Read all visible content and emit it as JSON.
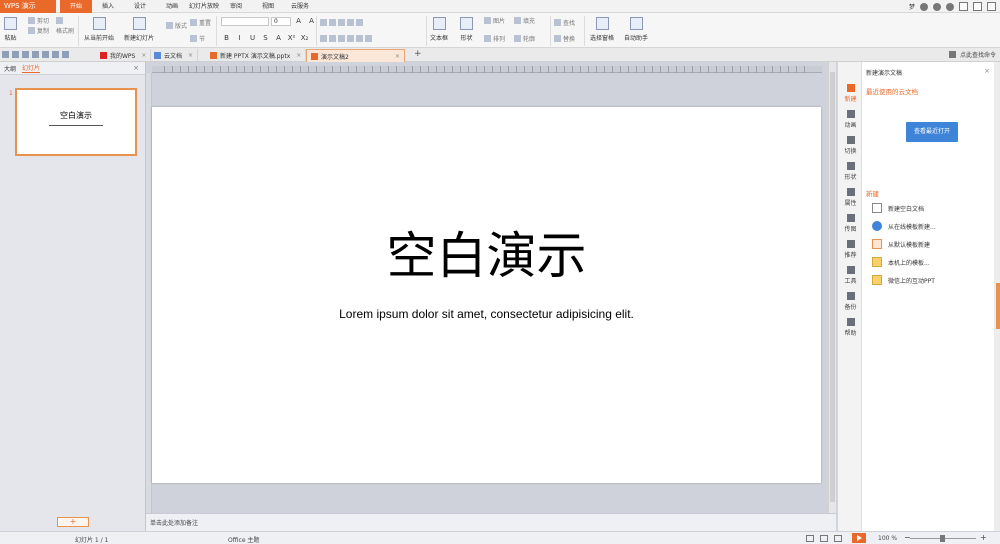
{
  "app": {
    "name": "WPS 演示",
    "user": "梦"
  },
  "menu": [
    "开始",
    "插入",
    "设计",
    "动画",
    "幻灯片放映",
    "审阅",
    "视图",
    "云服务"
  ],
  "ribbon": {
    "paste": "粘贴",
    "cut": "剪切",
    "copy": "复制",
    "format_painter": "格式刷",
    "from_current": "从当前开始",
    "new_slide": "新建幻灯片",
    "layout": "版式",
    "section": "节",
    "reset": "重置",
    "font_size": "0",
    "textbox": "文本框",
    "shape": "形状",
    "picture": "图片",
    "fill": "填充",
    "arrange": "排列",
    "outline": "轮廓",
    "find": "查找",
    "replace": "替换",
    "select_pane": "选择窗格",
    "auto_helper": "自动助手",
    "format_buttons": [
      "B",
      "I",
      "U",
      "S",
      "A",
      "X²",
      "X₂"
    ]
  },
  "doc_tabs": [
    {
      "label": "我的WPS"
    },
    {
      "label": "云文档"
    },
    {
      "label": "新建 PPTX 演示文稿.pptx"
    },
    {
      "label": "演示文稿2"
    }
  ],
  "find_command": "点此查找命令",
  "left_panel": {
    "tab_outline": "大纲",
    "tab_slides": "幻灯片",
    "slide_number": "1",
    "thumb_title": "空白演示",
    "add_label": "+"
  },
  "slide": {
    "title": "空白演示",
    "subtitle": "Lorem ipsum dolor sit amet, consectetur adipisicing elit."
  },
  "notes_placeholder": "单击此处添加备注",
  "right_icons": [
    "新建",
    "动画",
    "切换",
    "形状",
    "属性",
    "传图",
    "推荐",
    "工具",
    "备份",
    "帮助"
  ],
  "right_panel": {
    "header": "新建演示文稿",
    "recent": "最近使用的云文档",
    "open_button": "查看最近打开",
    "new_heading": "新建",
    "items": [
      "新建空白文档",
      "从在线模板新建...",
      "从默认模板新建",
      "本机上的模板...",
      "微信上的互动PPT"
    ]
  },
  "status": {
    "slide_info": "幻灯片 1 / 1",
    "theme": "Office 主题",
    "zoom": "100 %"
  }
}
